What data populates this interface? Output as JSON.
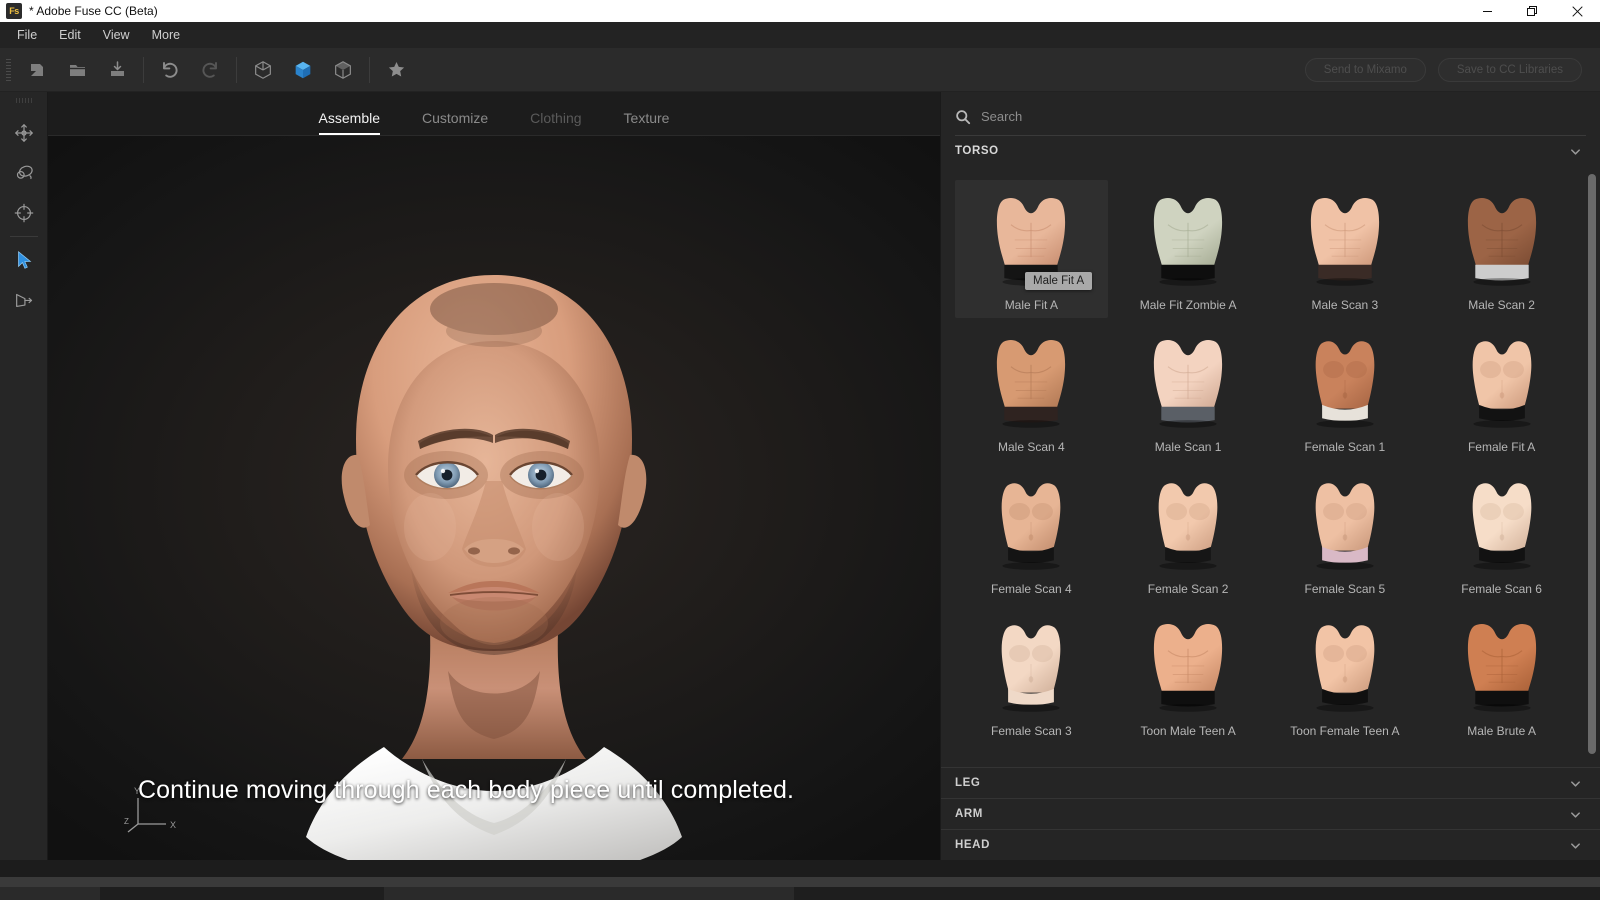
{
  "window": {
    "title": "* Adobe Fuse CC (Beta)",
    "app_icon": "Fs",
    "controls": [
      {
        "name": "minimize",
        "glyph": "minimize-icon"
      },
      {
        "name": "restore",
        "glyph": "restore-icon"
      },
      {
        "name": "close",
        "glyph": "close-icon"
      }
    ]
  },
  "menubar": {
    "items": [
      "File",
      "Edit",
      "View",
      "More"
    ]
  },
  "toolbar": {
    "buttons": [
      {
        "name": "new-file-icon",
        "state": "enabled"
      },
      {
        "name": "open-folder-icon",
        "state": "enabled"
      },
      {
        "name": "import-icon",
        "state": "enabled"
      },
      {
        "name": "undo-icon",
        "state": "enabled"
      },
      {
        "name": "redo-icon",
        "state": "disabled"
      },
      {
        "name": "wireframe-cube-icon",
        "state": "enabled"
      },
      {
        "name": "solid-cube-icon",
        "state": "active"
      },
      {
        "name": "shaded-cube-icon",
        "state": "enabled"
      },
      {
        "name": "favorite-star-icon",
        "state": "enabled"
      }
    ],
    "send_to_mixamo": "Send to Mixamo",
    "save_to_cc_libraries": "Save to CC Libraries",
    "accent_color": "#2f90e0"
  },
  "left_rail": {
    "tools": [
      {
        "name": "move-tool",
        "icon": "move-arrows-icon",
        "active": false
      },
      {
        "name": "orbit-tool",
        "icon": "orbit-icon",
        "active": false
      },
      {
        "name": "target-tool",
        "icon": "crosshair-target-icon",
        "active": false
      },
      {
        "name": "select-tool",
        "icon": "cursor-arrow-icon",
        "active": true
      },
      {
        "name": "camera-tool",
        "icon": "camera-export-icon",
        "active": false
      }
    ]
  },
  "tabs": [
    {
      "label": "Assemble",
      "active": true,
      "disabled": false
    },
    {
      "label": "Customize",
      "active": false,
      "disabled": false
    },
    {
      "label": "Clothing",
      "active": false,
      "disabled": true
    },
    {
      "label": "Texture",
      "active": false,
      "disabled": false
    }
  ],
  "viewport": {
    "caption": "Continue moving through each body piece until completed.",
    "gizmo": {
      "y": "Y",
      "x": "X",
      "z": "Z"
    },
    "background_color": "#1a1715"
  },
  "search": {
    "placeholder": "Search",
    "value": "",
    "icon": "search-icon"
  },
  "sections": {
    "torso": {
      "label": "TORSO",
      "expanded": true,
      "chevron": "chevron-down-icon"
    },
    "collapsed": [
      {
        "label": "LEG",
        "chevron": "chevron-down-icon"
      },
      {
        "label": "ARM",
        "chevron": "chevron-down-icon"
      },
      {
        "label": "HEAD",
        "chevron": "chevron-down-icon"
      }
    ]
  },
  "tooltip": {
    "text": "Male Fit A",
    "target_index": 0
  },
  "torso_items": [
    {
      "label": "Male Fit A",
      "selected": true,
      "skin": "#e8b79a",
      "shade": "#c98f72",
      "bottom": "#141414",
      "btype": "male"
    },
    {
      "label": "Male Fit Zombie A",
      "selected": false,
      "skin": "#cfd3c0",
      "shade": "#a7ad95",
      "bottom": "#0e0e0e",
      "btype": "male"
    },
    {
      "label": "Male Scan 3",
      "selected": false,
      "skin": "#f0c2a6",
      "shade": "#cf9a7c",
      "bottom": "#3a2b26",
      "btype": "male"
    },
    {
      "label": "Male Scan 2",
      "selected": false,
      "skin": "#9c6446",
      "shade": "#7d4d34",
      "bottom": "#cdcdcd",
      "btype": "male"
    },
    {
      "label": "Male Scan 4",
      "selected": false,
      "skin": "#d79a72",
      "shade": "#b37a56",
      "bottom": "#2f2320",
      "btype": "male"
    },
    {
      "label": "Male Scan 1",
      "selected": false,
      "skin": "#f3d3c0",
      "shade": "#d2ab95",
      "bottom": "#5a5f66",
      "btype": "male"
    },
    {
      "label": "Female Scan 1",
      "selected": false,
      "skin": "#c9825c",
      "shade": "#a96745",
      "bottom": "#e7e2da",
      "btype": "female"
    },
    {
      "label": "Female Fit A",
      "selected": false,
      "skin": "#f0c5a8",
      "shade": "#cf9d80",
      "bottom": "#121212",
      "btype": "female"
    },
    {
      "label": "Female Scan 4",
      "selected": false,
      "skin": "#e7b595",
      "shade": "#c48f70",
      "bottom": "#141414",
      "btype": "female"
    },
    {
      "label": "Female Scan 2",
      "selected": false,
      "skin": "#f2c9ad",
      "shade": "#d0a286",
      "bottom": "#161616",
      "btype": "female"
    },
    {
      "label": "Female Scan 5",
      "selected": false,
      "skin": "#eec0a3",
      "shade": "#cb9a7d",
      "bottom": "#d9b9c6",
      "btype": "female"
    },
    {
      "label": "Female Scan 6",
      "selected": false,
      "skin": "#f6ddc8",
      "shade": "#d6b69f",
      "bottom": "#121212",
      "btype": "female"
    },
    {
      "label": "Female Scan 3",
      "selected": false,
      "skin": "#f3d8c4",
      "shade": "#d2b29c",
      "bottom": "#efd9c8",
      "btype": "female"
    },
    {
      "label": "Toon Male Teen A",
      "selected": false,
      "skin": "#ecb08c",
      "shade": "#c88a67",
      "bottom": "#0f0f0f",
      "btype": "male"
    },
    {
      "label": "Toon Female Teen A",
      "selected": false,
      "skin": "#f2c4a6",
      "shade": "#cf9e80",
      "bottom": "#101010",
      "btype": "female"
    },
    {
      "label": "Male Brute A",
      "selected": false,
      "skin": "#cf7f52",
      "shade": "#ab6239",
      "bottom": "#0f0f0f",
      "btype": "male"
    }
  ]
}
